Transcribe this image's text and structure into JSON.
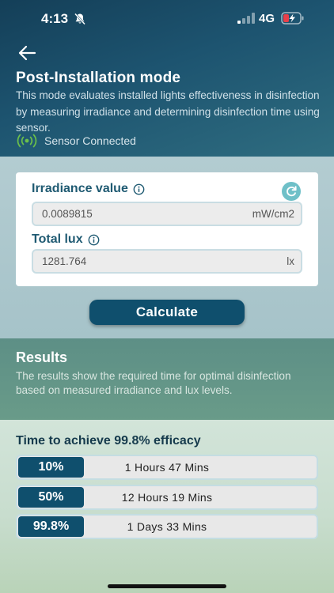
{
  "status_bar": {
    "time": "4:13",
    "network": "4G"
  },
  "header": {
    "title": "Post-Installation mode",
    "description": "This mode evaluates installed lights effectiveness in disinfection by measuring irradiance and determining disinfection time using sensor.",
    "sensor_status": "Sensor Connected"
  },
  "form": {
    "irradiance": {
      "label": "Irradiance value",
      "value": "0.0089815",
      "unit": "mW/cm2"
    },
    "lux": {
      "label": "Total lux",
      "value": "1281.764",
      "unit": "lx"
    },
    "calculate_label": "Calculate"
  },
  "results": {
    "title": "Results",
    "description": "The results show the required time for optimal disinfection based on measured irradiance and lux levels.",
    "efficacy_title": "Time to achieve 99.8% efficacy",
    "rows": [
      {
        "percent": "10%",
        "time": "1 Hours 47 Mins"
      },
      {
        "percent": "50%",
        "time": "12 Hours 19 Mins"
      },
      {
        "percent": "99.8%",
        "time": "1 Days 33 Mins"
      }
    ]
  },
  "colors": {
    "header_bg": "#1d5470",
    "accent": "#0f4f6d",
    "label_text": "#1f5a72",
    "refresh_icon": "#6fc0c8",
    "results_header_bg": "#5d8f86"
  },
  "icons": {
    "back": "arrow-left-icon",
    "bell": "bell-slash-icon",
    "signal": "signal-icon",
    "battery": "battery-charging-icon",
    "sensor": "wireless-signal-icon",
    "info": "info-icon",
    "refresh": "refresh-icon"
  }
}
